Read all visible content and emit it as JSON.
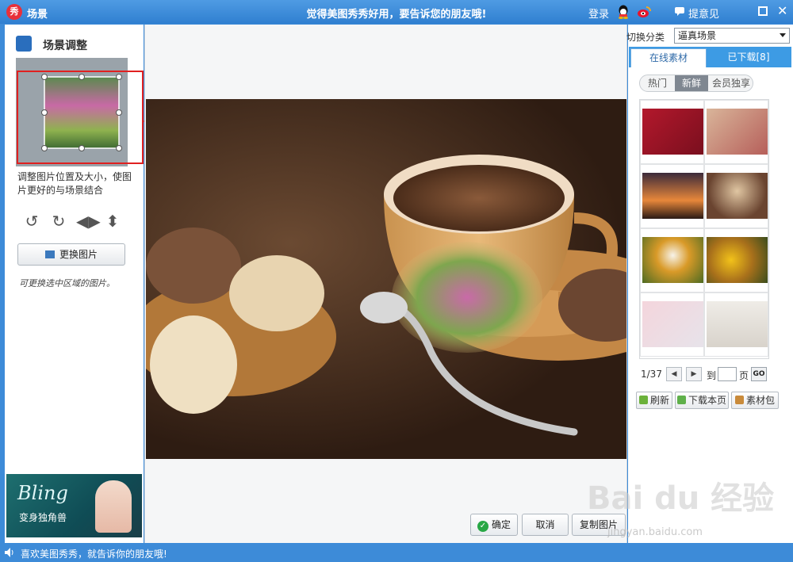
{
  "titlebar": {
    "logo": "秀",
    "title": "场景",
    "slogan": "觉得美图秀秀好用，要告诉您的朋友哦!",
    "login": "登录",
    "feedback": "提意见",
    "icons": [
      "qq-icon",
      "weibo-icon",
      "chat-icon",
      "maximize-icon",
      "close-icon"
    ]
  },
  "left_panel": {
    "header": "场景调整",
    "hint": "调整图片位置及大小，使图片更好的与场景结合",
    "tool_icons": [
      "rotate-left-icon",
      "rotate-right-icon",
      "flip-horizontal-icon",
      "flip-vertical-icon"
    ],
    "change_button": "更换图片",
    "note": "可更换选中区域的图片。",
    "ad": {
      "title": "Bling",
      "subtitle": "变身独角兽"
    }
  },
  "main": {
    "ok": "确定",
    "cancel": "取消",
    "copy": "复制图片"
  },
  "right_panel": {
    "category_label": "切换分类",
    "category_value": "逼真场景",
    "tabs": [
      "在线素材",
      "已下载[8]"
    ],
    "subtabs": [
      "热门",
      "新鲜",
      "会员独享"
    ],
    "active_subtab": "新鲜",
    "pager": {
      "current": "1/37",
      "to": "到",
      "page": "页",
      "go": "GO"
    },
    "actions": [
      "刷新",
      "下载本页",
      "素材包"
    ]
  },
  "statusbar": {
    "text": "喜欢美图秀秀，就告诉你的朋友哦!"
  },
  "watermark": {
    "brand": "Bai du 经验",
    "url": "jingyan.baidu.com"
  },
  "colors": {
    "accent": "#3d8bd8",
    "highlight": "#e02020",
    "ok_green": "#28a745"
  }
}
